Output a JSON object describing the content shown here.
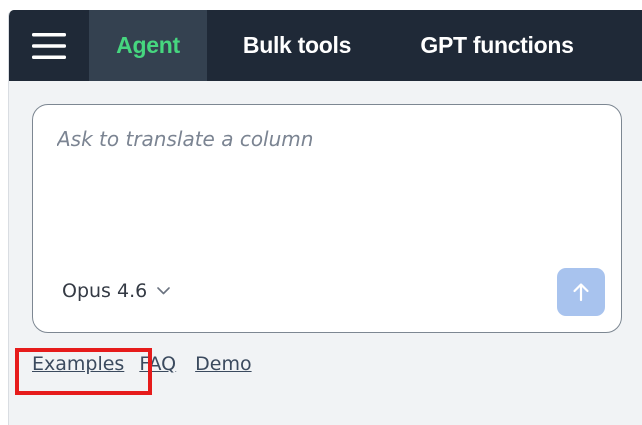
{
  "navbar": {
    "menu_icon": "hamburger-menu-icon",
    "tabs": [
      {
        "label": "Agent",
        "active": true
      },
      {
        "label": "Bulk tools",
        "active": false
      },
      {
        "label": "GPT functions",
        "active": false
      }
    ]
  },
  "composer": {
    "placeholder": "Ask to translate a column",
    "value": "",
    "model": {
      "label": "Opus 4.6",
      "icon": "chevron-down-icon"
    },
    "send_icon": "arrow-up-icon"
  },
  "links": {
    "examples": "Examples",
    "faq": "FAQ",
    "demo": "Demo"
  },
  "colors": {
    "navbar_bg": "#1f2937",
    "active_tab_bg": "#344150",
    "active_tab_text": "#46d67f",
    "send_button_bg": "#a8c3ee",
    "highlight_border": "#e61b1b",
    "panel_bg": "#f1f3f5"
  }
}
